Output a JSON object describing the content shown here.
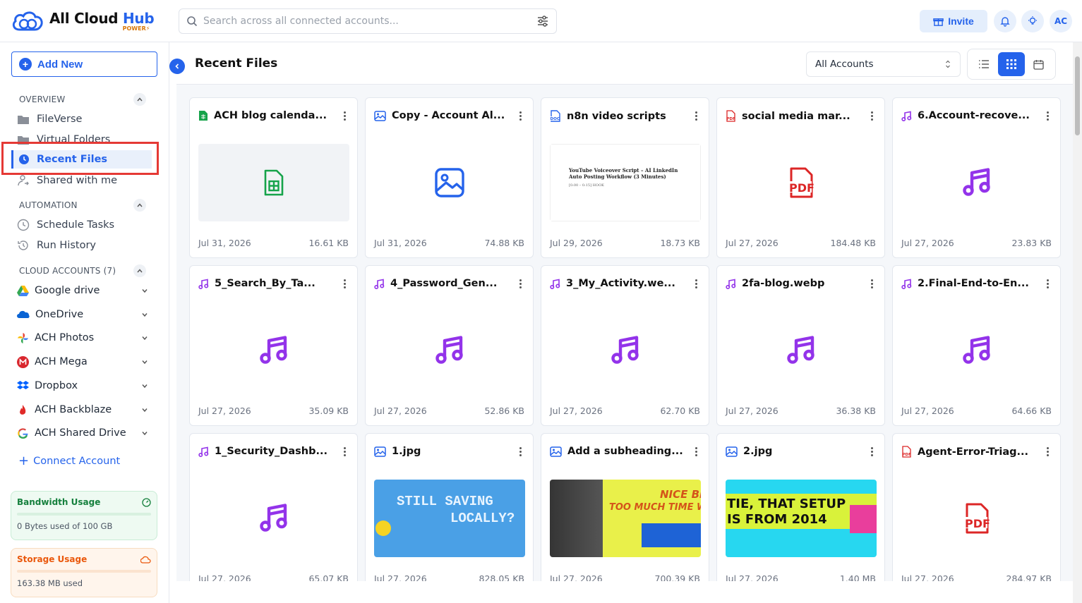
{
  "app": {
    "brand_title_a": "All Cloud ",
    "brand_title_b": "Hub",
    "brand_sub": "POWER",
    "brand_color": "#2563eb"
  },
  "topbar": {
    "search_placeholder": "Search across all connected accounts...",
    "invite_label": "Invite",
    "avatar_initials": "AC"
  },
  "sidebar": {
    "add_new_label": "Add New",
    "overview_heading": "OVERVIEW",
    "overview_items": [
      {
        "label": "FileVerse",
        "icon": "folder-icon"
      },
      {
        "label": "Virtual Folders",
        "icon": "folder-icon"
      },
      {
        "label": "Recent Files",
        "icon": "clock-icon",
        "active": true
      },
      {
        "label": "Shared with me",
        "icon": "user-share-icon"
      }
    ],
    "automation_heading": "AUTOMATION",
    "automation_items": [
      {
        "label": "Schedule Tasks",
        "icon": "clock-icon"
      },
      {
        "label": "Run History",
        "icon": "history-icon"
      }
    ],
    "cloud_heading": "CLOUD ACCOUNTS (7)",
    "cloud_accounts": [
      {
        "label": "Google drive",
        "icon": "google-drive-icon"
      },
      {
        "label": "OneDrive",
        "icon": "onedrive-icon"
      },
      {
        "label": "ACH Photos",
        "icon": "google-photos-icon"
      },
      {
        "label": "ACH Mega",
        "icon": "mega-icon"
      },
      {
        "label": "Dropbox",
        "icon": "dropbox-icon"
      },
      {
        "label": "ACH Backblaze",
        "icon": "backblaze-icon"
      },
      {
        "label": "ACH Shared Drive",
        "icon": "google-icon"
      }
    ],
    "connect_label": "Connect Account",
    "bandwidth": {
      "title": "Bandwidth Usage",
      "text": "0 Bytes used of 100 GB",
      "fraction": 0.0
    },
    "storage": {
      "title": "Storage Usage",
      "text": "163.38 MB used"
    }
  },
  "main": {
    "title": "Recent Files",
    "account_select": "All Accounts",
    "files": [
      {
        "name": "ACH blog calenda...",
        "type": "sheet",
        "date": "Jul 31, 2026",
        "size": "16.61 KB"
      },
      {
        "name": "Copy - Account Al...",
        "type": "image",
        "date": "Jul 31, 2026",
        "size": "74.88 KB"
      },
      {
        "name": "n8n video scripts",
        "type": "doc",
        "date": "Jul 29, 2026",
        "size": "18.73 KB"
      },
      {
        "name": "social media mar...",
        "type": "pdf",
        "date": "Jul 27, 2026",
        "size": "184.48 KB"
      },
      {
        "name": "6.Account-recove...",
        "type": "audio",
        "date": "Jul 27, 2026",
        "size": "23.83 KB"
      },
      {
        "name": "5_Search_By_Ta...",
        "type": "audio",
        "date": "Jul 27, 2026",
        "size": "35.09 KB"
      },
      {
        "name": "4_Password_Gen...",
        "type": "audio",
        "date": "Jul 27, 2026",
        "size": "52.86 KB"
      },
      {
        "name": "3_My_Activity.we...",
        "type": "audio",
        "date": "Jul 27, 2026",
        "size": "62.70 KB"
      },
      {
        "name": "2fa-blog.webp",
        "type": "audio",
        "date": "Jul 27, 2026",
        "size": "36.38 KB"
      },
      {
        "name": "2.Final-End-to-En...",
        "type": "audio",
        "date": "Jul 27, 2026",
        "size": "64.66 KB"
      },
      {
        "name": "1_Security_Dashb...",
        "type": "audio",
        "date": "Jul 27, 2026",
        "size": "65.07 KB"
      },
      {
        "name": "1.jpg",
        "type": "image-thumb-1",
        "date": "Jul 27, 2026",
        "size": "828.05 KB"
      },
      {
        "name": "Add a subheading...",
        "type": "image-thumb-2",
        "date": "Jul 27, 2026",
        "size": "700.39 KB"
      },
      {
        "name": "2.jpg",
        "type": "image-thumb-3",
        "date": "Jul 27, 2026",
        "size": "1.40 MB"
      },
      {
        "name": "Agent-Error-Triag...",
        "type": "pdf",
        "date": "Jul 27, 2026",
        "size": "284.97 KB"
      }
    ],
    "doc_thumb_title": "YouTube Voiceover Script – AI LinkedIn Auto Posting Workflow (3 Minutes)",
    "doc_thumb_line": "[0:00 – 0:15] HOOK",
    "thumb1_text_a": "STILL SAVING",
    "thumb1_text_b": "LOCALLY?",
    "thumb2_text_a": "NICE BIO",
    "thumb2_text_b": "TOO MUCH TIME W",
    "thumb3_text_a": "TIE, THAT SETUP",
    "thumb3_text_b": "IS FROM 2014"
  },
  "colors": {
    "accent": "#2563eb",
    "sheet": "#16a34a",
    "pdf": "#dc2626",
    "audio": "#9333ea",
    "image": "#2563eb",
    "highlight": "#e53935"
  }
}
